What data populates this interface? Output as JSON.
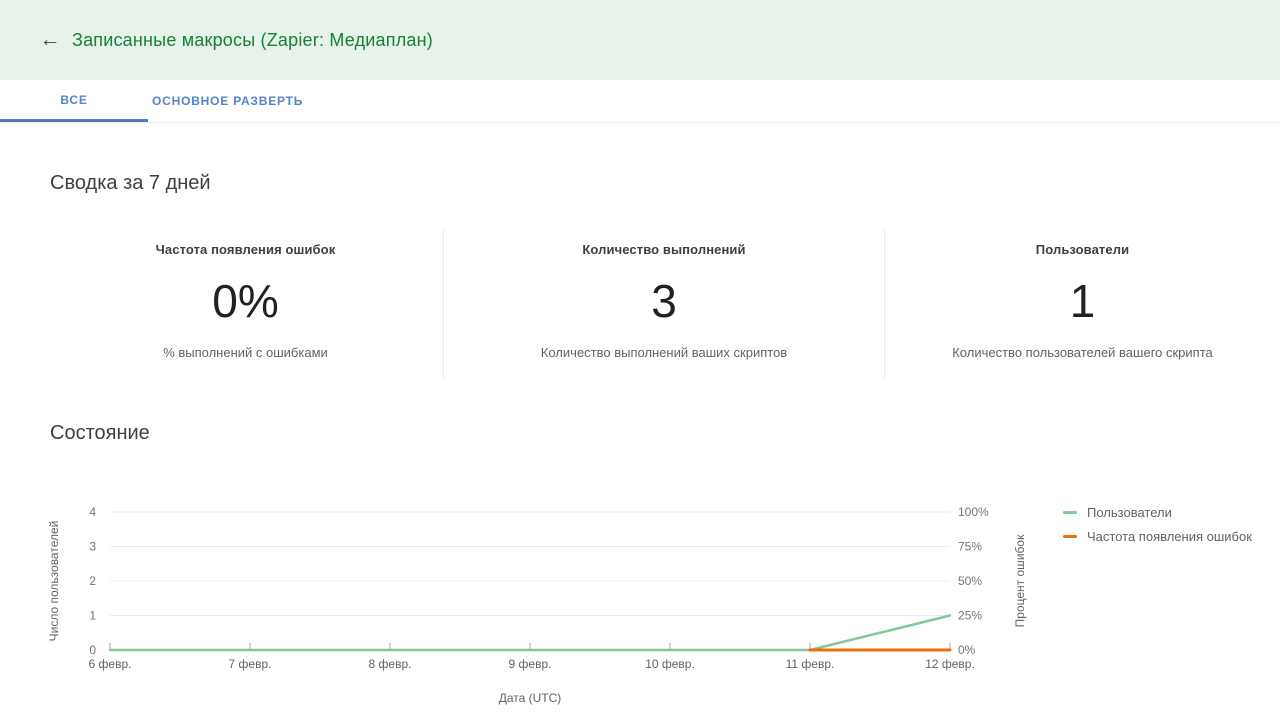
{
  "header": {
    "back_icon": "arrow-left",
    "title": "Записанные макросы (Zapier: Медиаплан)"
  },
  "tabs": [
    {
      "label": "ВСЕ",
      "active": true
    },
    {
      "label": "ОСНОВНОЕ РАЗВЕРТЬ",
      "active": false
    }
  ],
  "summary": {
    "title": "Сводка за 7 дней",
    "cards": [
      {
        "label": "Частота появления ошибок",
        "value": "0%",
        "description": "% выполнений с ошибками"
      },
      {
        "label": "Количество выполнений",
        "value": "3",
        "description": "Количество выполнений ваших скриптов"
      },
      {
        "label": "Пользователи",
        "value": "1",
        "description": "Количество пользователей вашего скрипта"
      }
    ]
  },
  "status": {
    "title": "Состояние"
  },
  "chart_data": {
    "type": "line",
    "title": "",
    "categories": [
      "6 февр.",
      "7 февр.",
      "8 февр.",
      "9 февр.",
      "10 февр.",
      "11 февр.",
      "12 февр."
    ],
    "series": [
      {
        "name": "Пользователи",
        "color": "#81c995",
        "axis": "left",
        "width": 2.5,
        "values": [
          0,
          0,
          0,
          0,
          0,
          0,
          1
        ]
      },
      {
        "name": "Частота появления ошибок",
        "color": "#e8710a",
        "axis": "right",
        "width": 3,
        "values": [
          null,
          null,
          null,
          null,
          null,
          0,
          0
        ]
      }
    ],
    "xlabel": "Дата (UTC)",
    "y_left": {
      "label": "Число пользователей",
      "ticks": [
        "0",
        "1",
        "2",
        "3",
        "4"
      ],
      "range": [
        0,
        4
      ]
    },
    "y_right": {
      "label": "Процент ошибок",
      "ticks": [
        "0%",
        "25%",
        "50%",
        "75%",
        "100%"
      ],
      "range": [
        0,
        100
      ]
    },
    "grid": true,
    "legend_position": "right"
  },
  "colors": {
    "header_bg": "#e6f2ea",
    "header_title": "#188038",
    "tab_blue": "#5585c4",
    "tab_underline": "#4c7cbd",
    "line_green": "#81c995",
    "line_orange": "#e8710a",
    "grid_line": "#ebebeb",
    "tick_mark": "#9aa0a6",
    "axis_text": "#757575",
    "label_text": "#5f6368"
  }
}
